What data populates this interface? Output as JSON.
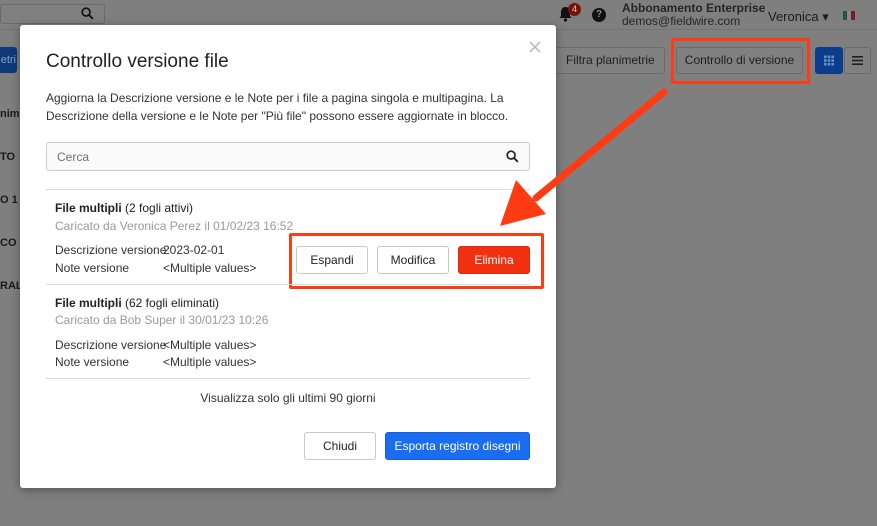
{
  "header": {
    "notification_count": "4",
    "help_glyph": "?",
    "plan": "Abbonamento Enterprise",
    "email": "demos@fieldwire.com",
    "user_name": "Veronica",
    "user_caret": "▾",
    "language_flag_colors": [
      "#009246",
      "#ffffff",
      "#ce2b37"
    ]
  },
  "background": {
    "left_button_fragment": "etri",
    "filter_button": "Filtra planimetrie",
    "version_button": "Controllo di versione",
    "left_list_fragments": [
      "nim",
      "TO",
      "O 1 (",
      "CO (",
      "RAL"
    ]
  },
  "modal": {
    "title": "Controllo versione file",
    "description": "Aggiorna la Descrizione versione e le Note per i file a pagina singola e multipagina. La Descrizione della versione e le Note per \"Più file\" possono essere aggiornate in blocco.",
    "search_placeholder": "Cerca",
    "entries": [
      {
        "title_bold": "File multipli",
        "title_rest": " (2 fogli attivi)",
        "uploaded": "Caricato da Veronica Perez il 01/02/23 16:52",
        "desc_label": "Descrizione versione",
        "desc_value": "2023-02-01",
        "notes_label": "Note versione",
        "notes_value": "<Multiple values>",
        "actions": {
          "expand": "Espandi",
          "edit": "Modifica",
          "delete": "Elimina"
        }
      },
      {
        "title_bold": "File multipli",
        "title_rest": " (62 fogli eliminati)",
        "uploaded": "Caricato da Bob Super il 30/01/23 10:26",
        "desc_label": "Descrizione versione",
        "desc_value": "<Multiple values>",
        "notes_label": "Note versione",
        "notes_value": "<Multiple values>"
      }
    ],
    "footer_note": "Visualizza solo gli ultimi 90 giorni",
    "close_label": "Chiudi",
    "export_label": "Esporta registro disegni"
  },
  "colors": {
    "highlight": "#ff3b14",
    "danger": "#f0300f",
    "primary": "#1a6cf0"
  }
}
